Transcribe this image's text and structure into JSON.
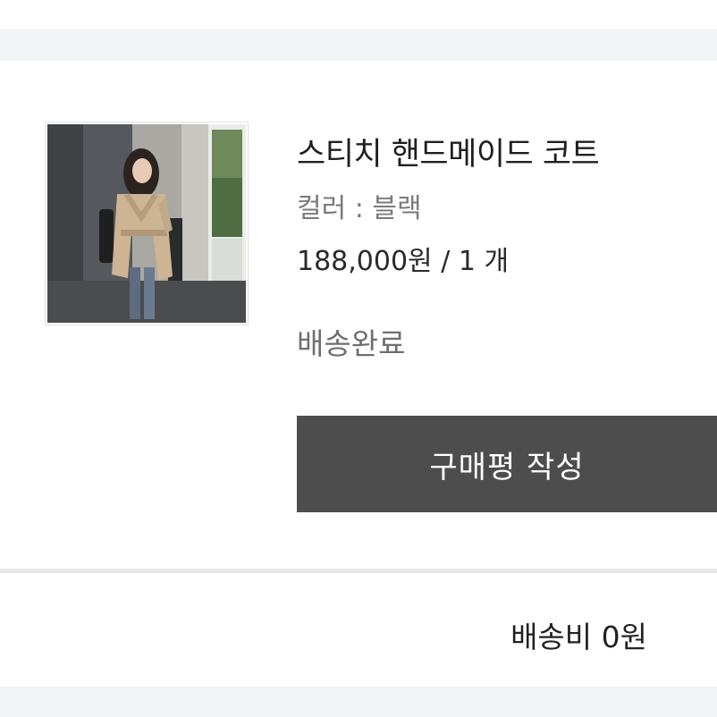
{
  "product": {
    "title": "스티치 핸드메이드 코트",
    "option": "컬러 : 블랙",
    "price_quantity": "188,000원 / 1 개",
    "image": "woman-in-beige-trench-coat-photo"
  },
  "order": {
    "status": "배송완료"
  },
  "actions": {
    "review_button_label": "구매평 작성"
  },
  "shipping": {
    "fee_label": "배송비 0원"
  },
  "colors": {
    "page_background": "#f2f3f4",
    "card_background": "#ffffff",
    "button_background": "#4d4d4d",
    "button_text": "#ffffff",
    "title_text": "#1f1f1f",
    "muted_text": "#7a7a7a"
  }
}
